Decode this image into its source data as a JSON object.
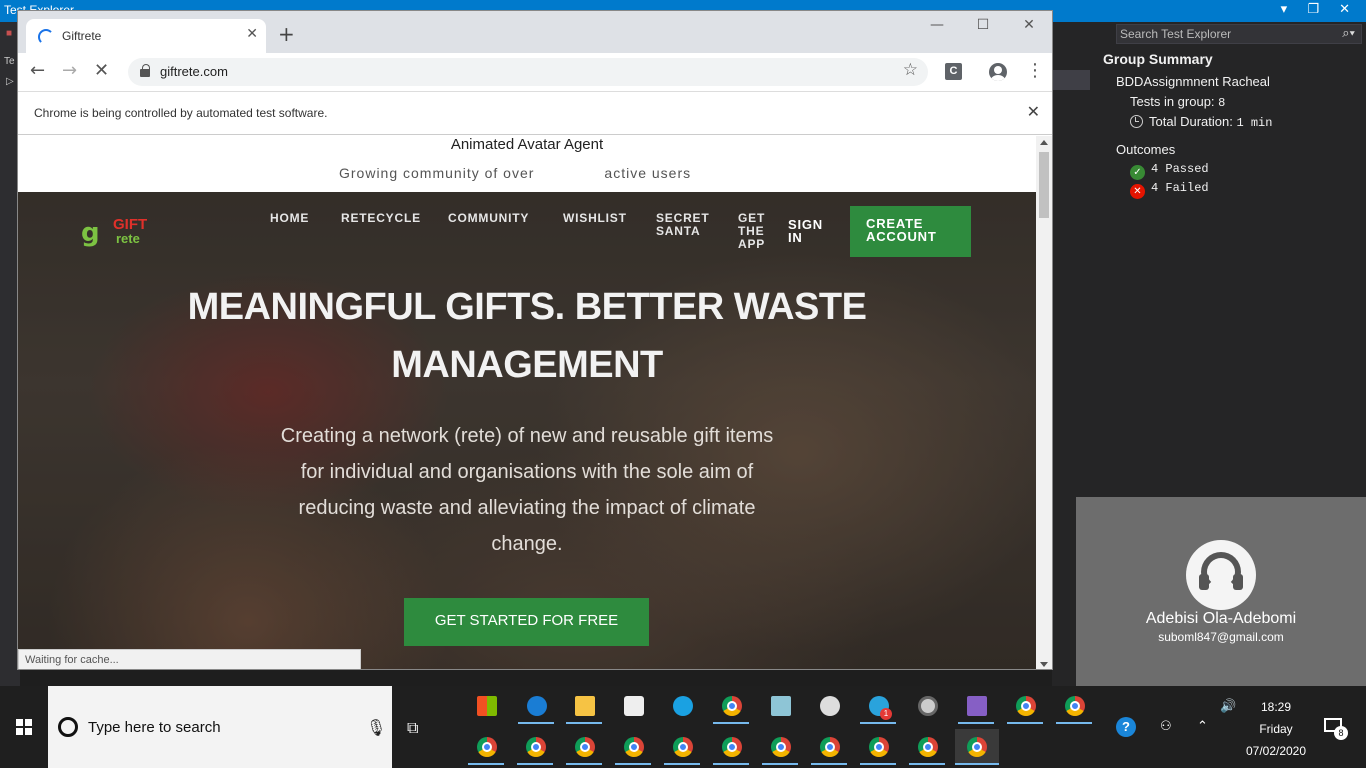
{
  "vs": {
    "title": "Test Explorer",
    "window_controls": "▾ ❐ ✕",
    "left_tabs": [
      "■",
      "Te",
      "▷"
    ]
  },
  "test_explorer": {
    "search_placeholder": "Search Test Explorer",
    "group_summary_title": "Group Summary",
    "group_name": "BDDAssignmnent Racheal",
    "tests_in_group_label": "Tests in group:",
    "tests_in_group_value": "8",
    "total_duration_label": "Total Duration:",
    "total_duration_value": "1 min",
    "outcomes_title": "Outcomes",
    "passed": "4 Passed",
    "failed": "4 Failed"
  },
  "avatar": {
    "name": "Adebisi Ola-Adebomi",
    "email": "suboml847@gmail.com"
  },
  "chrome": {
    "tab_title": "Giftrete",
    "url": "giftrete.com",
    "extension_letter": "C",
    "infobar_message": "Chrome is being controlled by automated test software."
  },
  "page": {
    "agent_title": "Animated Avatar Agent",
    "community_a": "Growing community of over",
    "community_b": "active users",
    "logo_top": "GIFT",
    "logo_bottom": "rete",
    "nav": [
      "HOME",
      "RETECYCLE",
      "COMMUNITY",
      "WISHLIST",
      "SECRET SANTA",
      "GET THE APP"
    ],
    "sign_in": "SIGN IN",
    "create_account": "CREATE ACCOUNT",
    "headline": "MEANINGFUL GIFTS. BETTER WASTE MANAGEMENT",
    "subtext": "Creating a network (rete) of new and reusable gift items for individual and organisations with the sole aim of reducing waste and alleviating the impact of climate change.",
    "cta": "GET STARTED FOR FREE",
    "status": "Waiting for cache..."
  },
  "taskbar": {
    "search_placeholder": "Type here to search",
    "time": "18:29",
    "day": "Friday",
    "date": "07/02/2020",
    "notification_count": "8",
    "telegram_badge": "1"
  }
}
